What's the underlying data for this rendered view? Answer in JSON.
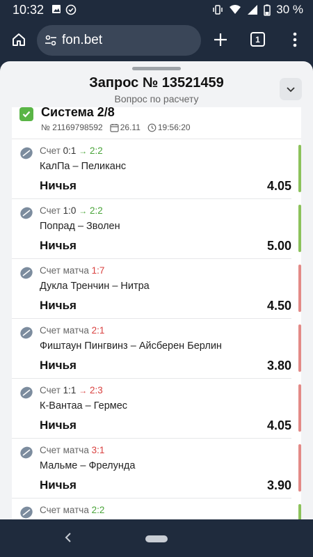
{
  "status_bar": {
    "time": "10:32",
    "battery": "30 %"
  },
  "browser": {
    "url": "fon.bet",
    "tab_count": "1"
  },
  "sheet": {
    "title": "Запрос № 13521459",
    "subtitle": "Вопрос по расчету"
  },
  "bet": {
    "system": "Система 2/8",
    "number": "№ 21169798592",
    "date": "26.11",
    "time": "19:56:20",
    "events": [
      {
        "score_label": "Счет",
        "score": "0:1",
        "arrow": "→",
        "new_score": "2:2",
        "teams": "КалПа – Пеликанс",
        "outcome": "Ничья",
        "odds": "4.05",
        "status": "won"
      },
      {
        "score_label": "Счет",
        "score": "1:0",
        "arrow": "→",
        "new_score": "2:2",
        "teams": "Попрад – Зволен",
        "outcome": "Ничья",
        "odds": "5.00",
        "status": "won"
      },
      {
        "score_label": "Счет матча",
        "score": "1:7",
        "teams": "Дукла Тренчин – Нитра",
        "outcome": "Ничья",
        "odds": "4.50",
        "status": "lost"
      },
      {
        "score_label": "Счет матча",
        "score": "2:1",
        "teams": "Фиштаун Пингвинз – Айсберен Берлин",
        "outcome": "Ничья",
        "odds": "3.80",
        "status": "lost"
      },
      {
        "score_label": "Счет",
        "score": "1:1",
        "arrow": "→",
        "new_score": "2:3",
        "teams": "К-Вантаа – Гермес",
        "outcome": "Ничья",
        "odds": "4.05",
        "status": "lost"
      },
      {
        "score_label": "Счет матча",
        "score": "3:1",
        "teams": "Мальме – Фрелунда",
        "outcome": "Ничья",
        "odds": "3.90",
        "status": "lost"
      },
      {
        "score_label": "Счет матча",
        "score": "2:2",
        "status": "won"
      }
    ]
  },
  "colors": {
    "won": "#8cc25b",
    "lost": "#e38a87",
    "check": "#5ab546",
    "chrome": "#1f2b3d"
  }
}
